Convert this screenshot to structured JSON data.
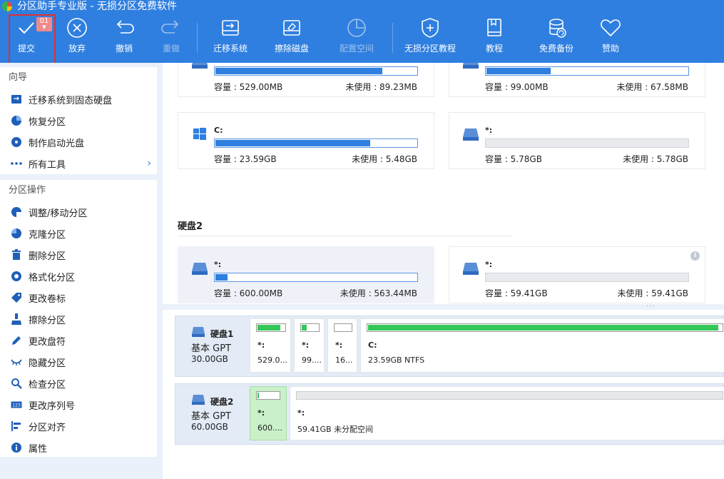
{
  "titlebar": {
    "title": "分区助手专业版 - 无损分区免费软件"
  },
  "toolbar": {
    "submit": {
      "label": "提交",
      "badge": "01"
    },
    "discard": {
      "label": "放弃"
    },
    "undo": {
      "label": "撤销"
    },
    "redo": {
      "label": "重做"
    },
    "migrate": {
      "label": "迁移系统"
    },
    "wipe": {
      "label": "擦除磁盘"
    },
    "allocate": {
      "label": "配置空间"
    },
    "tutorial_lossless": {
      "label": "无损分区教程"
    },
    "tutorial": {
      "label": "教程"
    },
    "backup": {
      "label": "免费备份"
    },
    "donate": {
      "label": "赞助"
    }
  },
  "sidebar": {
    "wizard": {
      "title": "向导",
      "items": [
        {
          "label": "迁移系统到固态硬盘",
          "icon": "migrate-icon"
        },
        {
          "label": "恢复分区",
          "icon": "pie-icon"
        },
        {
          "label": "制作启动光盘",
          "icon": "boot-disc-icon"
        },
        {
          "label": "所有工具",
          "icon": "more-icon"
        }
      ]
    },
    "ops": {
      "title": "分区操作",
      "items": [
        {
          "label": "调整/移动分区",
          "icon": "resize-icon"
        },
        {
          "label": "克隆分区",
          "icon": "clone-icon"
        },
        {
          "label": "删除分区",
          "icon": "trash-icon"
        },
        {
          "label": "格式化分区",
          "icon": "format-icon"
        },
        {
          "label": "更改卷标",
          "icon": "tag-icon"
        },
        {
          "label": "擦除分区",
          "icon": "brush-icon"
        },
        {
          "label": "更改盘符",
          "icon": "pencil-icon"
        },
        {
          "label": "隐藏分区",
          "icon": "eye-hidden-icon"
        },
        {
          "label": "检查分区",
          "icon": "check-icon"
        },
        {
          "label": "更改序列号",
          "icon": "serial-icon"
        },
        {
          "label": "分区对齐",
          "icon": "align-icon"
        },
        {
          "label": "属性",
          "icon": "info-icon"
        }
      ]
    }
  },
  "cards": {
    "top_left": {
      "name": "",
      "capacity": "容量 : 529.00MB",
      "free": "未使用 : 89.23MB",
      "used_fraction": 0.83
    },
    "top_right": {
      "name": "",
      "capacity": "容量 : 99.00MB",
      "free": "未使用 : 67.58MB",
      "used_fraction": 0.32
    },
    "c": {
      "name": "C:",
      "capacity": "容量 : 23.59GB",
      "free": "未使用 : 5.48GB",
      "used_fraction": 0.77
    },
    "star1": {
      "name": "*:",
      "capacity": "容量 : 5.78GB",
      "free": "未使用 : 5.78GB",
      "used_fraction": 0
    },
    "d2p1": {
      "name": "*:",
      "capacity": "容量 : 600.00MB",
      "free": "未使用 : 563.44MB",
      "used_fraction": 0.06
    },
    "d2p2": {
      "name": "*:",
      "capacity": "容量 : 59.41GB",
      "free": "未使用 : 59.41GB",
      "used_fraction": 0
    }
  },
  "disk2_heading": "硬盘2",
  "disks": [
    {
      "name": "硬盘1",
      "type": "基本 GPT",
      "size": "30.00GB",
      "partitions": [
        {
          "l1": "*:",
          "l2": "529.0...",
          "used_fraction": 0.83
        },
        {
          "l1": "*:",
          "l2": "99....",
          "used_fraction": 0.32
        },
        {
          "l1": "*:",
          "l2": "16...",
          "used_fraction": 0
        },
        {
          "l1": "C:",
          "l2": "23.59GB NTFS",
          "used_fraction": 0.99
        }
      ]
    },
    {
      "name": "硬盘2",
      "type": "基本 GPT",
      "size": "60.00GB",
      "partitions": [
        {
          "l1": "*:",
          "l2": "600....",
          "used_fraction": 0.06
        },
        {
          "l1": "*:",
          "l2": "59.41GB 未分配空间",
          "used_fraction": 0
        }
      ]
    }
  ],
  "colors": {
    "accent": "#2f7fe0",
    "green": "#34c759",
    "highlight": "#e03030"
  }
}
